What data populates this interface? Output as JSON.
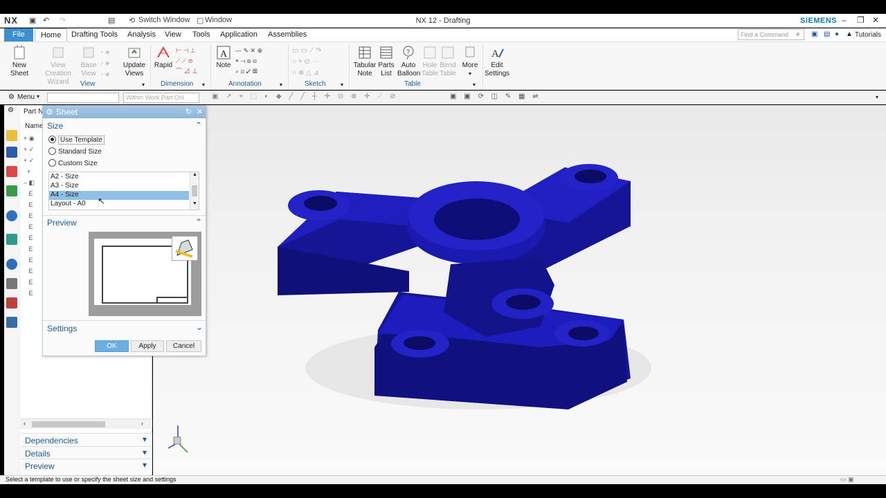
{
  "app": {
    "logo": "NX",
    "title": "NX 12 - Drafting",
    "brand": "SIEMENS",
    "switch_window": "Switch Window",
    "window_menu": "Window"
  },
  "tabs": [
    "File",
    "Home",
    "Drafting Tools",
    "Analysis",
    "View",
    "Tools",
    "Application",
    "Assemblies"
  ],
  "find_command": {
    "placeholder": "Find a Command"
  },
  "tutorials": "Tutorials",
  "ribbon": {
    "new_sheet": [
      "New",
      "Sheet"
    ],
    "view_creation_wizard": [
      "View Creation",
      "Wizard"
    ],
    "base_view": [
      "Base",
      "View"
    ],
    "update_views": [
      "Update",
      "Views"
    ],
    "rapid": "Rapid",
    "note": "Note",
    "tabular_note": [
      "Tabular",
      "Note"
    ],
    "parts_list": [
      "Parts",
      "List"
    ],
    "auto_balloon": [
      "Auto",
      "Balloon"
    ],
    "hole_table": [
      "Hole",
      "Table"
    ],
    "bend_table": [
      "Bend",
      "Table"
    ],
    "more": "More",
    "edit_settings": [
      "Edit",
      "Settings"
    ],
    "groups": {
      "view": "View",
      "dimension": "Dimension",
      "annotation": "Annotation",
      "sketch": "Sketch",
      "table": "Table"
    }
  },
  "toolbar2": {
    "menu": "Menu",
    "filter": "Within Work Part Onl"
  },
  "navigator": {
    "header_part": "Part N",
    "header_name": "Name",
    "accordions": [
      "Dependencies",
      "Details",
      "Preview"
    ]
  },
  "dialog": {
    "title": "Sheet",
    "section_size": "Size",
    "radios": [
      {
        "label": "Use Template",
        "selected": true
      },
      {
        "label": "Standard Size",
        "selected": false
      },
      {
        "label": "Custom Size",
        "selected": false
      }
    ],
    "templates": [
      "A2 - Size",
      "A3 - Size",
      "A4 - Size",
      "Layout - A0"
    ],
    "selected_template": "A4 - Size",
    "section_preview": "Preview",
    "section_settings": "Settings",
    "ok": "OK",
    "apply": "Apply",
    "cancel": "Cancel"
  },
  "status": "Select a template to use or specify the sheet size and settings",
  "colors": {
    "accent": "#3d8fd0",
    "part_blue": "#1a1aa8",
    "dialog_title": "#a6c7e4"
  }
}
